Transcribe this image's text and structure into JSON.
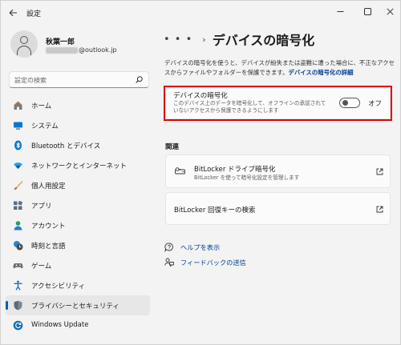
{
  "app": {
    "title": "設定"
  },
  "window_controls": {
    "minimize": "—",
    "maximize": "☐",
    "close": "✕"
  },
  "profile": {
    "name": "秋葉一郎",
    "email_visible": "@outlook.jp"
  },
  "search": {
    "placeholder": "設定の検索"
  },
  "nav": {
    "items": [
      {
        "label": "ホーム",
        "icon": "home-icon"
      },
      {
        "label": "システム",
        "icon": "system-icon"
      },
      {
        "label": "Bluetooth とデバイス",
        "icon": "bluetooth-icon"
      },
      {
        "label": "ネットワークとインターネット",
        "icon": "network-icon"
      },
      {
        "label": "個人用設定",
        "icon": "brush-icon"
      },
      {
        "label": "アプリ",
        "icon": "apps-icon"
      },
      {
        "label": "アカウント",
        "icon": "account-icon"
      },
      {
        "label": "時刻と言語",
        "icon": "time-language-icon"
      },
      {
        "label": "ゲーム",
        "icon": "gaming-icon"
      },
      {
        "label": "アクセシビリティ",
        "icon": "accessibility-icon"
      },
      {
        "label": "プライバシーとセキュリティ",
        "icon": "shield-icon",
        "selected": true
      },
      {
        "label": "Windows Update",
        "icon": "windows-update-icon"
      }
    ]
  },
  "content": {
    "breadcrumb_more": "• • •",
    "breadcrumb_sep": "›",
    "page_title": "デバイスの暗号化",
    "description": "デバイスの暗号化を使うと、デバイスが紛失または盗難に遭った場合に、不正なアクセスからファイルやフォルダーを保護できます。",
    "description_link": "デバイスの暗号化の詳細",
    "encryption_card": {
      "title": "デバイスの暗号化",
      "subtitle_line1": "このデバイス上のデータを暗号化して、オフラインの承認されて",
      "subtitle_line2": "いないアクセスから保護できるようにします",
      "toggle_label": "オフ",
      "toggle_on": false
    },
    "related_label": "関連",
    "bitlocker_card": {
      "title": "BitLocker ドライブ暗号化",
      "subtitle": "BitLocker を使って暗号化設定を管理します"
    },
    "recovery_card": {
      "title": "BitLocker 回復キーの検索"
    },
    "links": {
      "help": "ヘルプを表示",
      "feedback": "フィードバックの送信"
    }
  },
  "colors": {
    "accent": "#005fb8",
    "link": "#003e92",
    "highlight": "#e00000"
  }
}
